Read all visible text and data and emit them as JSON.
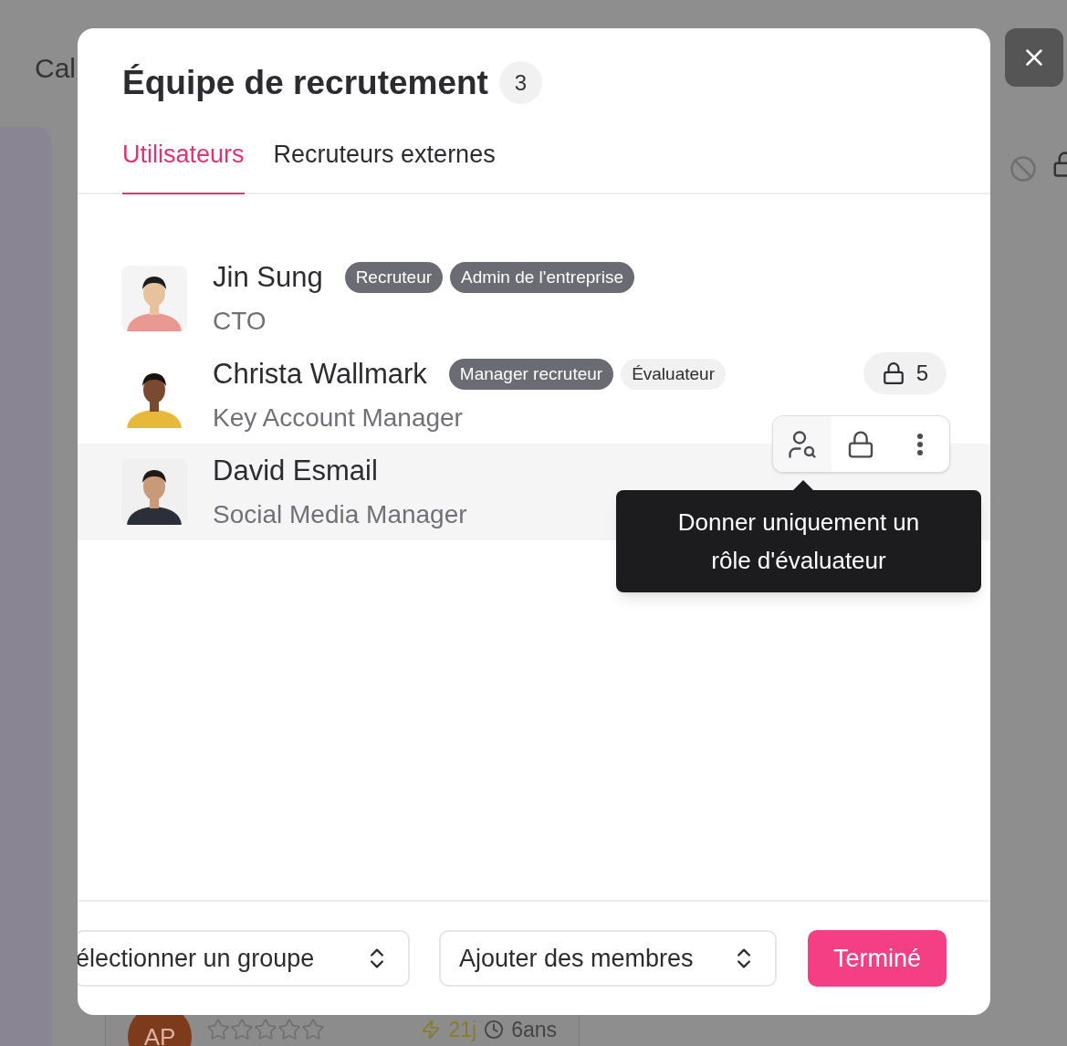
{
  "background": {
    "heading": "Cal",
    "card": {
      "initials": "AP",
      "stars": 0,
      "days": "21j",
      "age": "6ans"
    }
  },
  "modal": {
    "title": "Équipe de recrutement",
    "count": "3",
    "tabs": [
      {
        "label": "Utilisateurs",
        "selected": true
      },
      {
        "label": "Recruteurs externes",
        "selected": false
      }
    ],
    "members": [
      {
        "name": "Jin Sung",
        "title": "CTO",
        "hovered": false,
        "roles": [
          {
            "label": "Recruteur",
            "kind": "dark"
          },
          {
            "label": "Admin de l'entreprise",
            "kind": "dark"
          }
        ]
      },
      {
        "name": "Christa Wallmark",
        "title": "Key Account Manager",
        "hovered": false,
        "lock_count": "5",
        "roles": [
          {
            "label": "Manager recruteur",
            "kind": "dark"
          },
          {
            "label": "Évaluateur",
            "kind": "light"
          }
        ]
      },
      {
        "name": "David Esmail",
        "title": "Social Media Manager",
        "hovered": true
      }
    ],
    "tooltip": "Donner uniquement un rôle d'évaluateur",
    "footer": {
      "group_select": "électionner un groupe",
      "members_select": "Ajouter des membres",
      "done": "Terminé"
    }
  }
}
